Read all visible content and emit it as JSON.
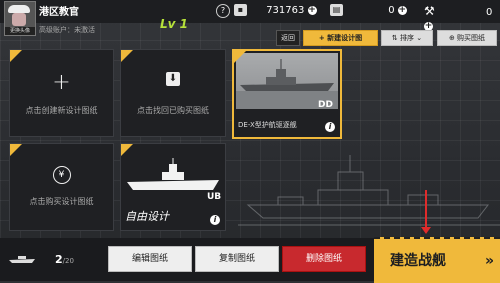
{
  "player": {
    "avatar_label": "更换头像",
    "name": "港区教官",
    "account": "高级账户：未激活",
    "level": "Lv 1"
  },
  "resources": {
    "gold": "731763",
    "ticket": "0",
    "gear": "0"
  },
  "icons": {
    "help": "?",
    "gold": "gold-icon",
    "ticket": "ticket-icon",
    "gear": "gear-icon"
  },
  "toolbar": {
    "back": "返回",
    "new_design": "新建设计图",
    "sort": "排序",
    "buy_design": "购买图纸"
  },
  "cards": [
    {
      "text": "点击创建新设计图纸",
      "icon": "plus-icon"
    },
    {
      "text": "点击找回已购买图纸",
      "icon": "download-icon"
    },
    {
      "caption": "DE-X型护航驱逐舰",
      "tag": "DD",
      "icon": "info-icon"
    },
    {
      "text": "点击购买设计图纸",
      "icon": "yen-icon"
    },
    {
      "caption": "自由设计",
      "tag": "UB",
      "icon": "info-icon"
    }
  ],
  "bottom": {
    "count": "2",
    "total": "/20",
    "edit": "编辑图纸",
    "copy": "复制图纸",
    "delete": "删除图纸",
    "build": "建造战舰"
  },
  "colors": {
    "accent": "#f0b93b",
    "danger": "#c8292e",
    "level": "#b7e23a"
  }
}
